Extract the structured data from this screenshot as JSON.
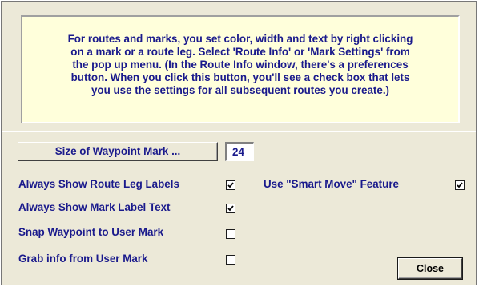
{
  "info": {
    "text": "For routes and marks, you set color, width and text by right clicking\non a mark or a route leg.  Select 'Route Info' or 'Mark Settings' from\nthe pop up menu.  (In the Route Info window, there's a preferences\nbutton. When you click this button, you'll see a check box that lets\nyou use the settings for all subsequent routes you create.)"
  },
  "waypoint_size": {
    "label": "Size of Waypoint Mark ...",
    "value": "24"
  },
  "options": {
    "route_leg_labels": {
      "label": "Always Show Route Leg Labels",
      "checked": true
    },
    "mark_label_text": {
      "label": "Always Show Mark Label Text",
      "checked": true
    },
    "snap_waypoint": {
      "label": "Snap Waypoint to User Mark",
      "checked": false
    },
    "grab_info": {
      "label": "Grab info from User Mark",
      "checked": false
    },
    "smart_move": {
      "label": "Use \"Smart Move\" Feature",
      "checked": true
    }
  },
  "buttons": {
    "close": "Close"
  },
  "colors": {
    "text": "#1a1a8c",
    "info_background": "#ffffdb",
    "dialog_background": "#ece9d8"
  }
}
